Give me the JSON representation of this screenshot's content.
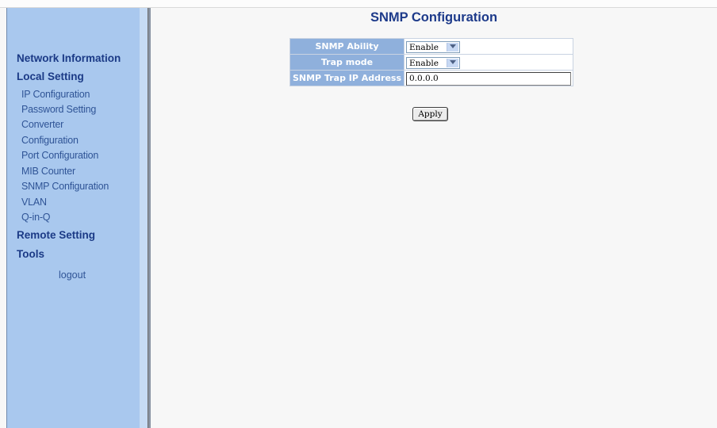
{
  "page_title": "SNMP Configuration",
  "sidebar": {
    "sections": [
      {
        "label": "Network Information"
      },
      {
        "label": "Local Setting"
      },
      {
        "label": "Remote Setting"
      },
      {
        "label": "Tools"
      }
    ],
    "local_items": [
      {
        "label": "IP Configuration"
      },
      {
        "label": "Password Setting"
      },
      {
        "label": "Converter"
      },
      {
        "label": "Configuration"
      },
      {
        "label": "Port Configuration"
      },
      {
        "label": "MIB Counter"
      },
      {
        "label": "SNMP Configuration"
      },
      {
        "label": "VLAN"
      },
      {
        "label": "Q-in-Q"
      }
    ],
    "logout": "logout"
  },
  "form": {
    "snmp_ability": {
      "label": "SNMP Ability",
      "value": "Enable"
    },
    "trap_mode": {
      "label": "Trap mode",
      "value": "Enable"
    },
    "trap_ip": {
      "label": "SNMP Trap IP Address",
      "value": "0.0.0.0"
    }
  },
  "apply_label": "Apply",
  "colors": {
    "sidebar_bg": "#a9c8ee",
    "label_cell_bg": "#8fb0dc",
    "title_color": "#1d3a8a",
    "nav_head_color": "#1b3a86"
  },
  "icons": {
    "select_arrow": "chevron-down-icon"
  }
}
